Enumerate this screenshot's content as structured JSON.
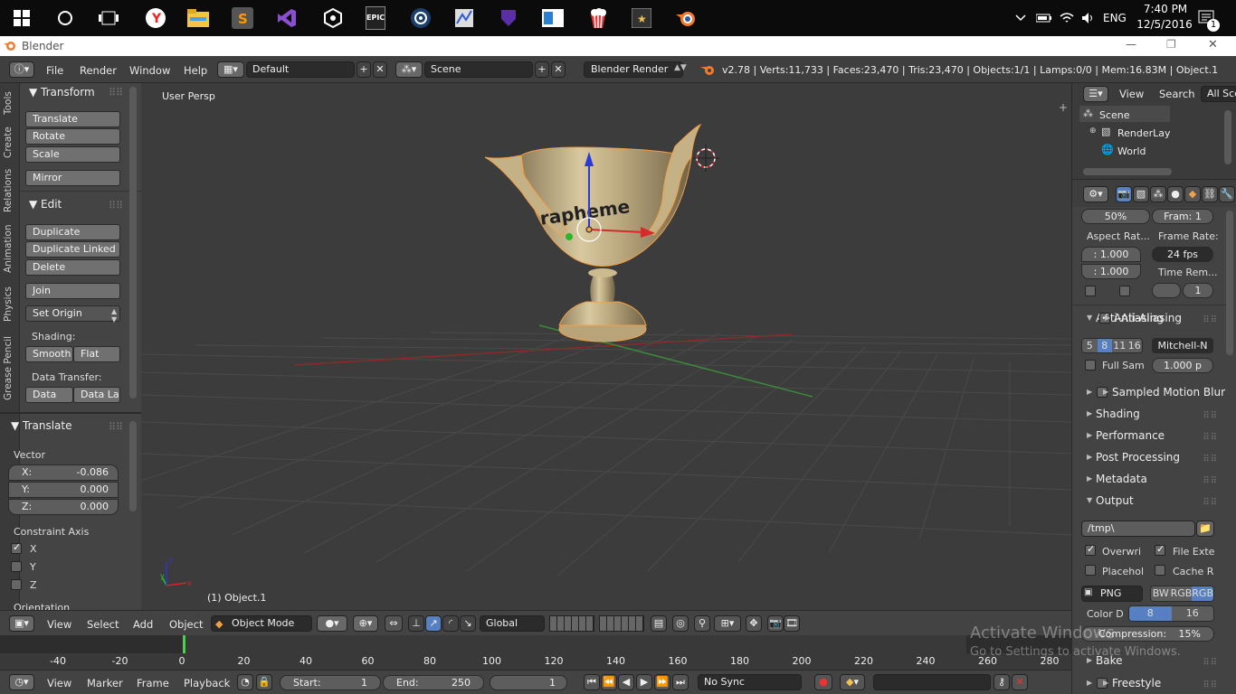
{
  "taskbar": {
    "icons": [
      "windows-start-icon",
      "cortana-icon",
      "task-view-icon",
      "yandex-browser-icon",
      "file-explorer-icon",
      "sublime-text-icon",
      "visual-studio-icon",
      "unity-icon",
      "epic-games-icon",
      "steam-icon",
      "photo-app-icon",
      "visual-studio-preview-icon",
      "windows-app-icon",
      "popcorn-icon",
      "movie-app-icon",
      "blender-icon"
    ],
    "epic_label": "EPIC",
    "lang": "ENG",
    "time": "7:40 PM",
    "date": "12/5/2016",
    "notification_count": "1"
  },
  "window": {
    "title": "Blender",
    "minimize": "—",
    "maximize": "❐",
    "close": "✕"
  },
  "info_header": {
    "menus": [
      "File",
      "Render",
      "Window",
      "Help"
    ],
    "layout": "Default",
    "scene": "Scene",
    "engine": "Blender Render",
    "stats": "v2.78 | Verts:11,733 | Faces:23,470 | Tris:23,470 | Objects:1/1 | Lamps:0/0 | Mem:16.83M | Object.1"
  },
  "left_tabs": [
    "Tools",
    "Create",
    "Relations",
    "Animation",
    "Physics",
    "Grease Pencil"
  ],
  "tool_shelf": {
    "transform_title": "Transform",
    "translate": "Translate",
    "rotate": "Rotate",
    "scale": "Scale",
    "mirror": "Mirror",
    "edit_title": "Edit",
    "duplicate": "Duplicate",
    "duplicate_linked": "Duplicate Linked",
    "delete": "Delete",
    "join": "Join",
    "set_origin": "Set Origin",
    "shading_label": "Shading:",
    "smooth": "Smooth",
    "flat": "Flat",
    "data_transfer_label": "Data Transfer:",
    "data": "Data",
    "data_layout": "Data La"
  },
  "operator_panel": {
    "title": "Translate",
    "vector_label": "Vector",
    "x_label": "X:",
    "x_value": "-0.086",
    "y_label": "Y:",
    "y_value": "0.000",
    "z_label": "Z:",
    "z_value": "0.000",
    "constraint_label": "Constraint Axis",
    "axes": [
      "X",
      "Y",
      "Z"
    ],
    "orientation_label": "Orientation"
  },
  "viewport": {
    "view_name": "User Persp",
    "object_label": "(1) Object.1",
    "trophy_text": "rapheme"
  },
  "view_header": {
    "menus": [
      "View",
      "Select",
      "Add",
      "Object"
    ],
    "mode": "Object Mode",
    "orientation": "Global"
  },
  "timeline": {
    "ticks": [
      "-40",
      "-20",
      "0",
      "20",
      "40",
      "60",
      "80",
      "100",
      "120",
      "140",
      "160",
      "180",
      "200",
      "220",
      "240",
      "260",
      "280"
    ],
    "menus": [
      "View",
      "Marker",
      "Frame",
      "Playback"
    ],
    "start_label": "Start:",
    "start_value": "1",
    "end_label": "End:",
    "end_value": "250",
    "current_frame": "1",
    "sync": "No Sync"
  },
  "outliner": {
    "view": "View",
    "search": "Search",
    "filter": "All Sce",
    "items": [
      "Scene",
      "RenderLay",
      "World"
    ]
  },
  "properties": {
    "resolution_pct": "50%",
    "frame_step": "Fram: 1",
    "aspect_label": "Aspect Rat...",
    "frame_rate_label": "Frame Rate:",
    "aspect_x": ": 1.000",
    "aspect_y": ": 1.000",
    "fps": "24 fps",
    "time_remap_label": "Time Rem...",
    "time_remap_value": "1",
    "aa_title": "Anti-Aliasing",
    "aa_samples": [
      "5",
      "8",
      "11",
      "16"
    ],
    "aa_filter": "Mitchell-N",
    "full_sample": "Full Sam",
    "filter_size": "1.000 p",
    "sampled_motion_blur": "Sampled Motion Blur",
    "shading": "Shading",
    "performance": "Performance",
    "post_processing": "Post Processing",
    "metadata": "Metadata",
    "output": "Output",
    "output_path": "/tmp\\",
    "overwrite": "Overwri",
    "file_ext": "File Exte",
    "placeholders": "Placehol",
    "cache_result": "Cache R",
    "format": "PNG",
    "bw": "BW",
    "rgb": "RGB",
    "rgba": "RGB",
    "color_depth_label": "Color D",
    "depth_8": "8",
    "depth_16": "16",
    "compression": "Compression:",
    "compression_value": "15%",
    "bake": "Bake",
    "freestyle": "Freestyle"
  },
  "watermark": {
    "line1": "Activate Windows",
    "line2": "Go to Settings to activate Windows."
  },
  "colors": {
    "accent_blue": "#5680c2",
    "selected_orange": "#f2a048",
    "trophy_gold": "#c8b48a",
    "grid_red": "#8a2a2a",
    "grid_green": "#3b8a3b"
  }
}
